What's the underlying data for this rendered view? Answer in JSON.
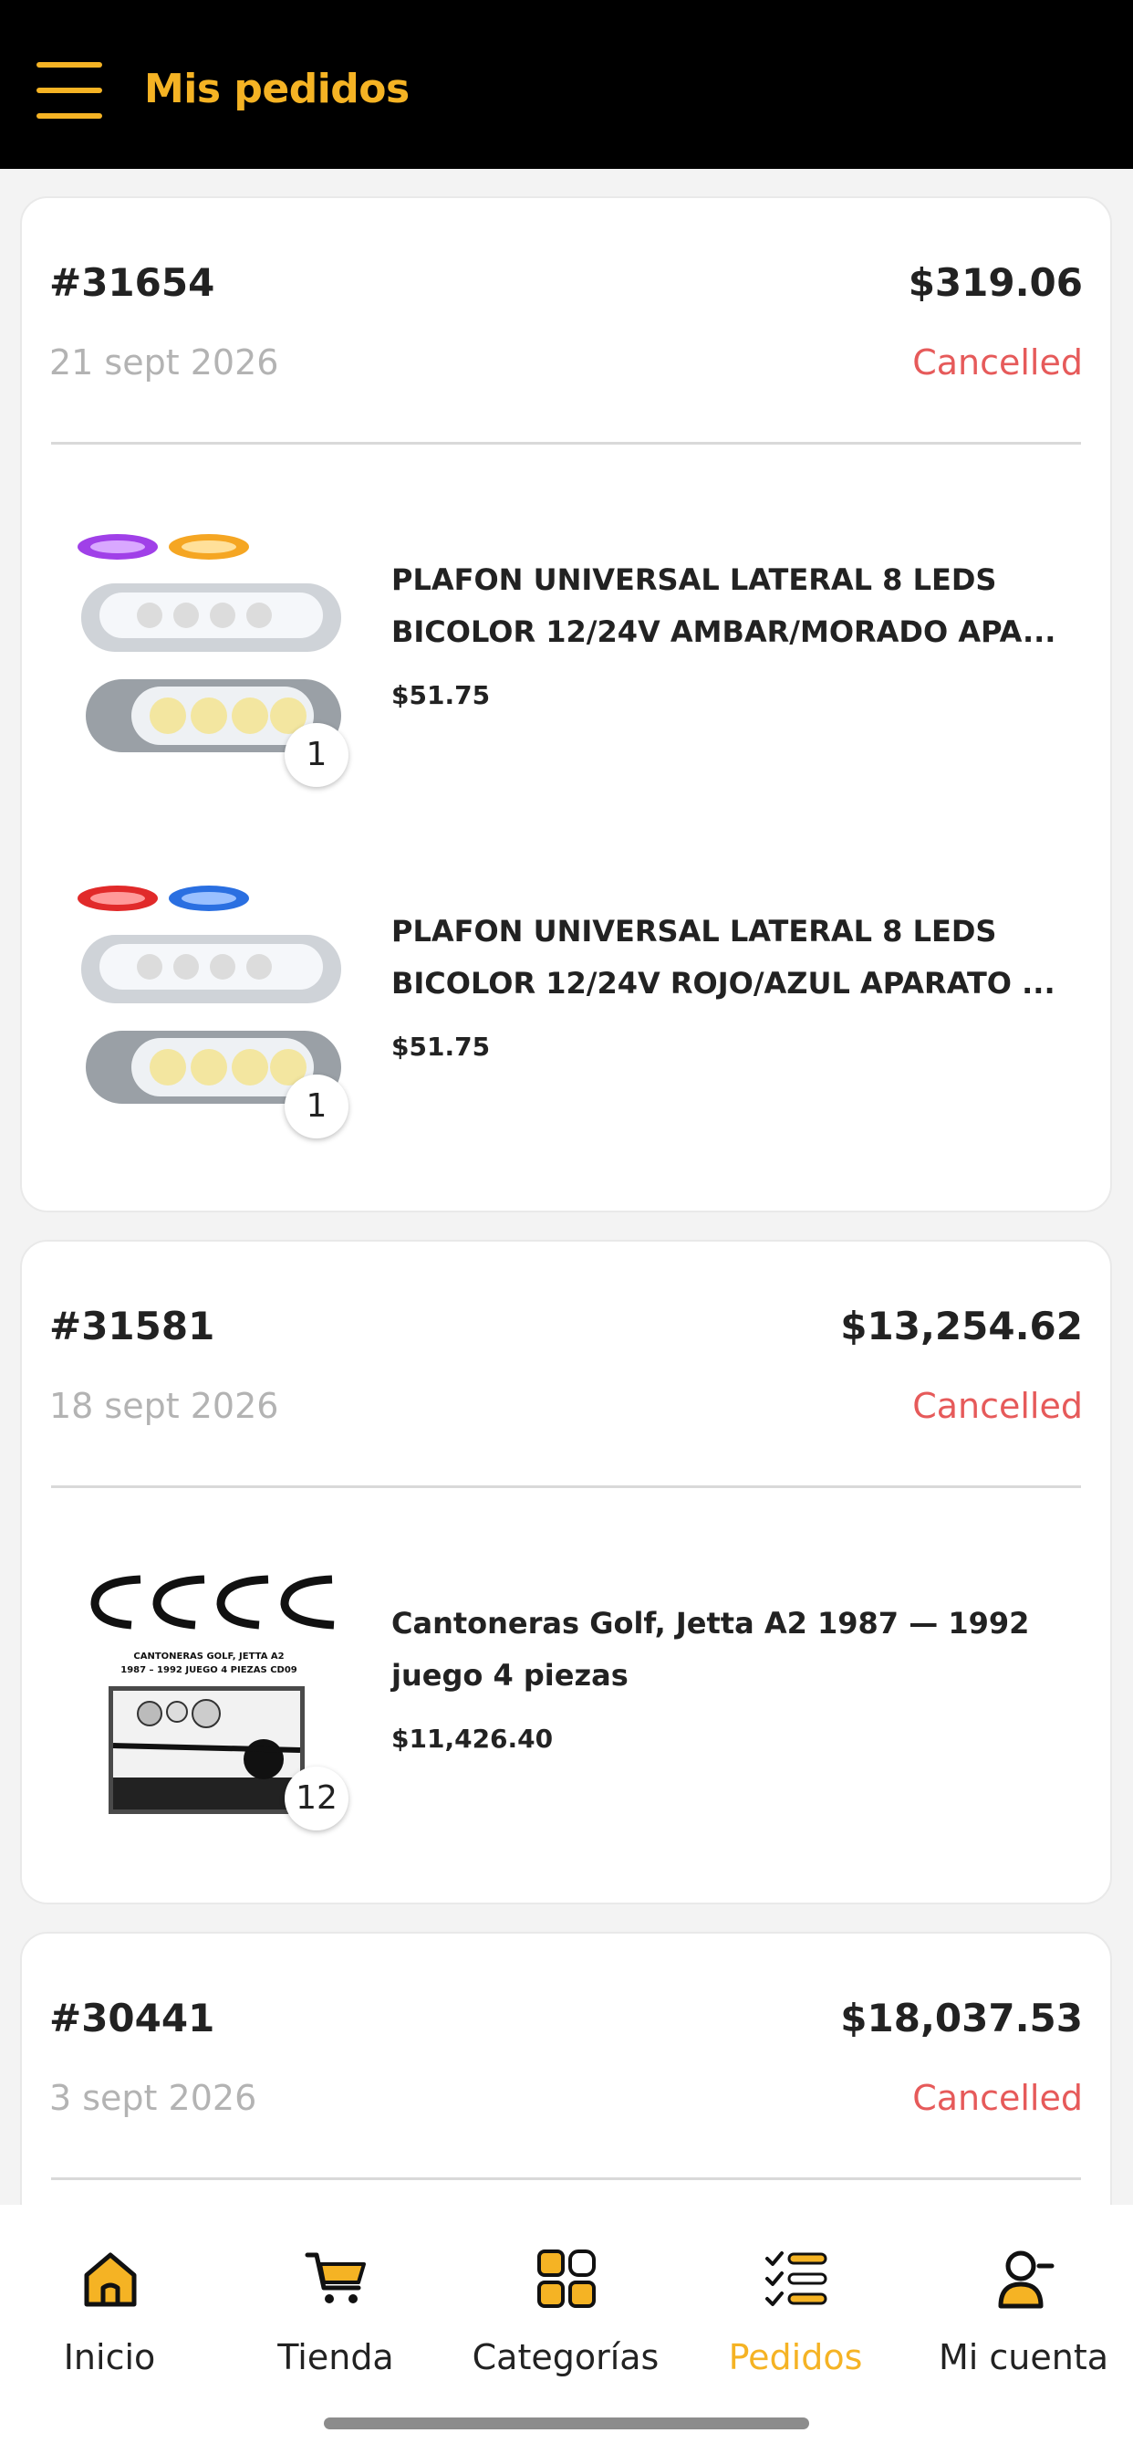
{
  "header": {
    "title": "Mis pedidos",
    "menu_icon": "hamburger-menu-icon"
  },
  "orders": [
    {
      "id": "#31654",
      "total": "$319.06",
      "date": "21 sept 2026",
      "status": "Cancelled",
      "items": [
        {
          "name": "PLAFON UNIVERSAL LATERAL 8 LEDS\nBICOLOR 12/24V AMBAR/MORADO APA...",
          "price": "$51.75",
          "qty": "1"
        },
        {
          "name": "PLAFON UNIVERSAL LATERAL 8 LEDS\nBICOLOR 12/24V ROJO/AZUL APARATO ...",
          "price": "$51.75",
          "qty": "1"
        }
      ]
    },
    {
      "id": "#31581",
      "total": "$13,254.62",
      "date": "18 sept 2026",
      "status": "Cancelled",
      "items": [
        {
          "name": "Cantoneras Golf, Jetta A2 1987 — 1992\njuego 4 piezas",
          "price": "$11,426.40",
          "qty": "12",
          "image_caption": "CANTONERAS GOLF, JETTA A2\n1987 – 1992 JUEGO 4 PIEZAS  CD09"
        }
      ]
    },
    {
      "id": "#30441",
      "total": "$18,037.53",
      "date": "3 sept 2026",
      "status": "Cancelled",
      "items": []
    }
  ],
  "tabs": [
    {
      "label": "Inicio",
      "icon": "home-icon",
      "active": false
    },
    {
      "label": "Tienda",
      "icon": "cart-icon",
      "active": false
    },
    {
      "label": "Categorías",
      "icon": "grid-icon",
      "active": false
    },
    {
      "label": "Pedidos",
      "icon": "checklist-icon",
      "active": true
    },
    {
      "label": "Mi cuenta",
      "icon": "user-icon",
      "active": false
    }
  ],
  "colors": {
    "accent": "#f5b324",
    "cancelled": "#e65a5a",
    "header_bg": "#000000"
  }
}
